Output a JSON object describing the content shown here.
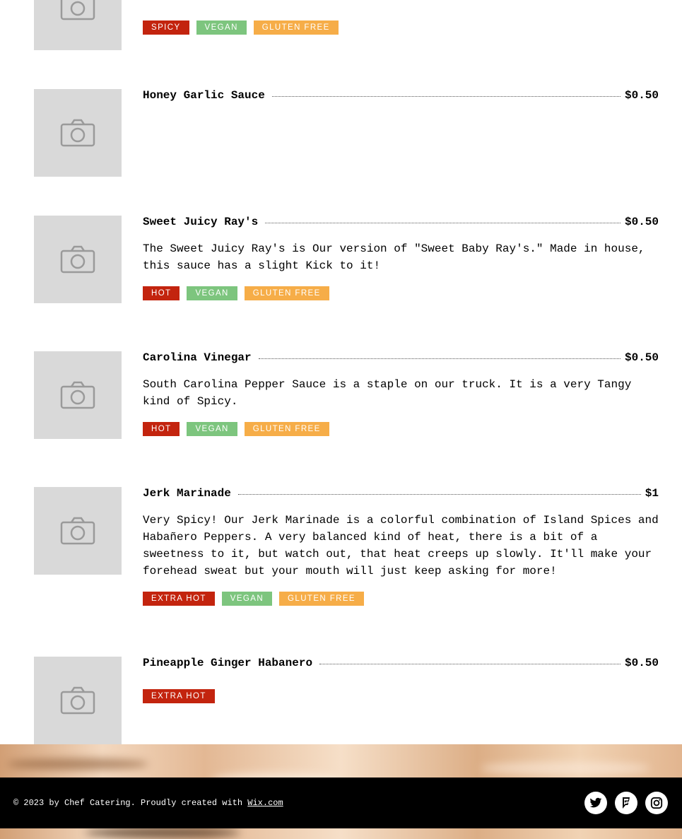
{
  "items": [
    {
      "name": "",
      "price": "",
      "description": "",
      "tags": [
        {
          "label": "Spicy",
          "color": "#c3240e"
        },
        {
          "label": "Vegan",
          "color": "#7dc57e"
        },
        {
          "label": "Gluten Free",
          "color": "#f6ad48"
        }
      ]
    },
    {
      "name": "Honey Garlic Sauce",
      "price": "$0.50",
      "description": "",
      "tags": []
    },
    {
      "name": "Sweet Juicy Ray's",
      "price": "$0.50",
      "description": "The Sweet Juicy Ray's is Our version of \"Sweet Baby Ray's.\" Made in house, this sauce has a slight Kick to it!",
      "tags": [
        {
          "label": "Hot",
          "color": "#c3240e"
        },
        {
          "label": "Vegan",
          "color": "#7dc57e"
        },
        {
          "label": "Gluten Free",
          "color": "#f6ad48"
        }
      ]
    },
    {
      "name": "Carolina Vinegar",
      "price": "$0.50",
      "description": "South Carolina Pepper Sauce is a staple on our truck. It is a very Tangy kind of Spicy.",
      "tags": [
        {
          "label": "Hot",
          "color": "#c3240e"
        },
        {
          "label": "Vegan",
          "color": "#7dc57e"
        },
        {
          "label": "Gluten Free",
          "color": "#f6ad48"
        }
      ]
    },
    {
      "name": "Jerk Marinade",
      "price": "$1",
      "description": "Very Spicy! Our Jerk Marinade is a colorful combination of Island Spices and Habañero Peppers. A very balanced kind of heat, there is a bit of a sweetness to it, but watch out, that heat creeps up slowly. It'll make your forehead sweat but your mouth will just keep asking for more!",
      "tags": [
        {
          "label": "Extra Hot",
          "color": "#c3240e"
        },
        {
          "label": "Vegan",
          "color": "#7dc57e"
        },
        {
          "label": "Gluten Free",
          "color": "#f6ad48"
        }
      ]
    },
    {
      "name": "Pineapple Ginger Habanero",
      "price": "$0.50",
      "description": "",
      "tags": [
        {
          "label": "Extra Hot",
          "color": "#c3240e"
        }
      ]
    }
  ],
  "footer": {
    "copyright": "© 2023 by Chef Catering. Proudly created with ",
    "link_text": "Wix.com",
    "social": [
      "twitter-icon",
      "foursquare-icon",
      "instagram-icon"
    ]
  }
}
